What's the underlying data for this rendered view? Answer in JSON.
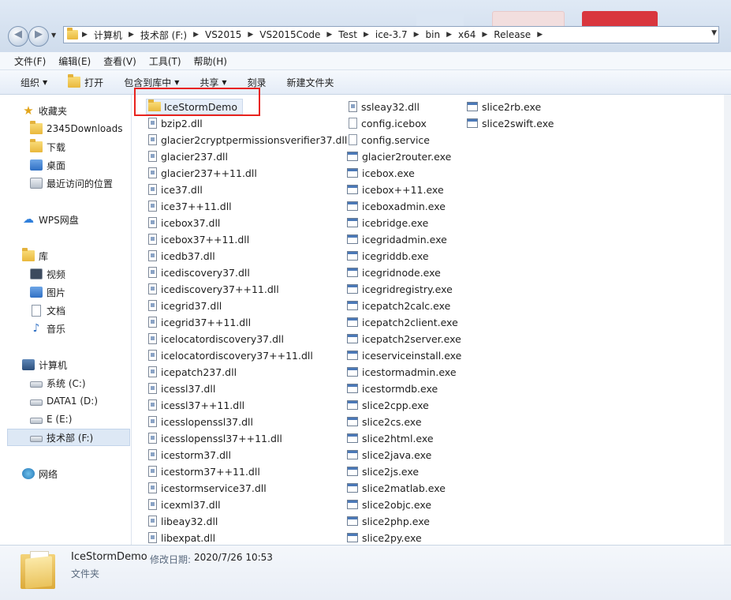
{
  "address": {
    "crumbs": [
      "计算机",
      "技术部 (F:)",
      "VS2015",
      "VS2015Code",
      "Test",
      "ice-3.7",
      "bin",
      "x64",
      "Release"
    ]
  },
  "menu": [
    "文件(F)",
    "编辑(E)",
    "查看(V)",
    "工具(T)",
    "帮助(H)"
  ],
  "toolbar": {
    "organize": "组织",
    "open": "打开",
    "include_library": "包含到库中",
    "share": "共享",
    "burn": "刻录",
    "new_folder": "新建文件夹"
  },
  "nav": {
    "favorites": "收藏夹",
    "fav_items": [
      "2345Downloads",
      "下载",
      "桌面",
      "最近访问的位置"
    ],
    "wps": "WPS网盘",
    "library": "库",
    "lib_items": [
      "视频",
      "图片",
      "文档",
      "音乐"
    ],
    "computer": "计算机",
    "drives": [
      "系统 (C:)",
      "DATA1 (D:)",
      "E (E:)",
      "技术部 (F:)"
    ],
    "network": "网络"
  },
  "files": {
    "col1": [
      "IceStormDemo",
      "bzip2.dll",
      "glacier2cryptpermissionsverifier37.dll",
      "glacier237.dll",
      "glacier237++11.dll",
      "ice37.dll",
      "ice37++11.dll",
      "icebox37.dll",
      "icebox37++11.dll",
      "icedb37.dll",
      "icediscovery37.dll",
      "icediscovery37++11.dll",
      "icegrid37.dll",
      "icegrid37++11.dll",
      "icelocatordiscovery37.dll",
      "icelocatordiscovery37++11.dll",
      "icepatch237.dll",
      "icessl37.dll",
      "icessl37++11.dll",
      "icesslopenssl37.dll",
      "icesslopenssl37++11.dll",
      "icestorm37.dll",
      "icestorm37++11.dll",
      "icestormservice37.dll",
      "icexml37.dll",
      "libeay32.dll",
      "libexpat.dll"
    ],
    "col2": [
      "ssleay32.dll",
      "config.icebox",
      "config.service",
      "glacier2router.exe",
      "icebox.exe",
      "icebox++11.exe",
      "iceboxadmin.exe",
      "icebridge.exe",
      "icegridadmin.exe",
      "icegriddb.exe",
      "icegridnode.exe",
      "icegridregistry.exe",
      "icepatch2calc.exe",
      "icepatch2client.exe",
      "icepatch2server.exe",
      "iceserviceinstall.exe",
      "icestormadmin.exe",
      "icestormdb.exe",
      "slice2cpp.exe",
      "slice2cs.exe",
      "slice2html.exe",
      "slice2java.exe",
      "slice2js.exe",
      "slice2matlab.exe",
      "slice2objc.exe",
      "slice2php.exe",
      "slice2py.exe"
    ],
    "col3": [
      "slice2rb.exe",
      "slice2swift.exe"
    ]
  },
  "details": {
    "name": "IceStormDemo",
    "modified_label": "修改日期:",
    "modified_value": "2020/7/26 10:53",
    "type": "文件夹"
  }
}
